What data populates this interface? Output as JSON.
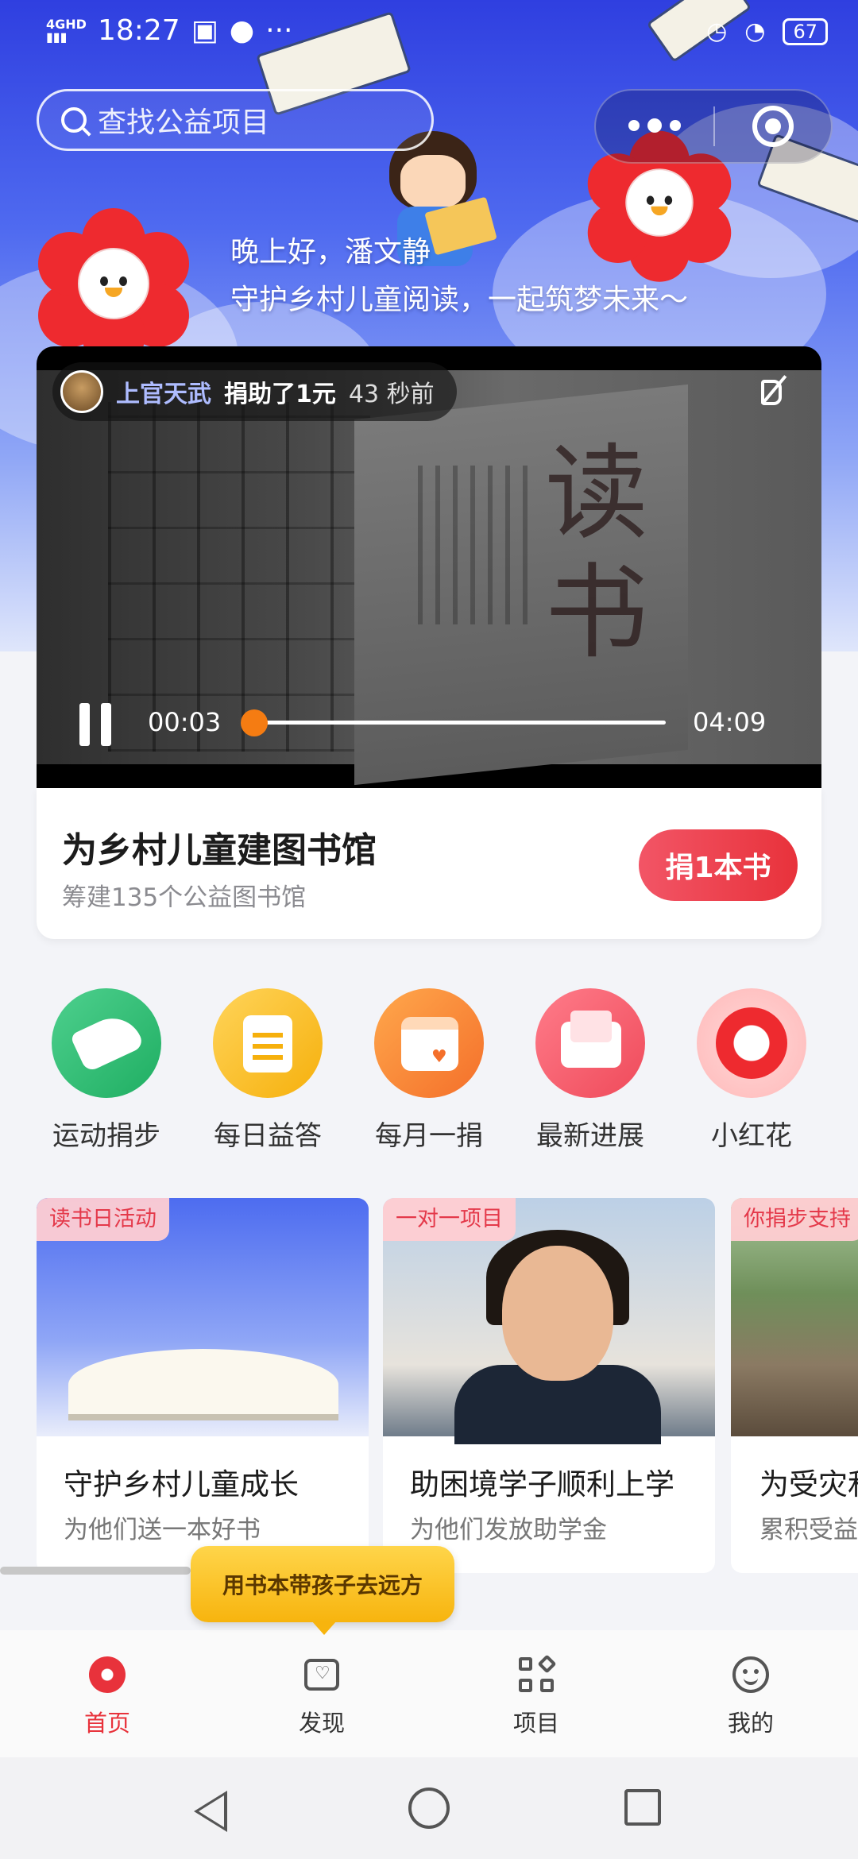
{
  "status_bar": {
    "network": "4GHD",
    "time": "18:27",
    "battery": "67"
  },
  "search": {
    "placeholder": "查找公益项目"
  },
  "greeting": {
    "line1": "晚上好，潘文静",
    "line2": "守护乡村儿童阅读，一起筑梦未来～"
  },
  "video": {
    "donor_name": "上官天武",
    "donor_action": "捐助了1元",
    "donor_time": "43 秒前",
    "current_time": "00:03",
    "total_time": "04:09",
    "progress": 0.012
  },
  "campaign": {
    "title": "为乡村儿童建图书馆",
    "subtitle": "筹建135个公益图书馆",
    "button": "捐1本书"
  },
  "shortcuts": [
    {
      "label": "运动捐步",
      "icon": "shoe-icon"
    },
    {
      "label": "每日益答",
      "icon": "quiz-icon"
    },
    {
      "label": "每月一捐",
      "icon": "calendar-icon"
    },
    {
      "label": "最新进展",
      "icon": "inbox-icon"
    },
    {
      "label": "小红花",
      "icon": "red-flower-icon"
    }
  ],
  "projects": [
    {
      "tag": "读书日活动",
      "title": "守护乡村儿童成长",
      "subtitle": "为他们送一本好书"
    },
    {
      "tag": "一对一项目",
      "title": "助困境学子顺利上学",
      "subtitle": "为他们发放助学金"
    },
    {
      "tag": "你捐步支持",
      "title": "为受灾和",
      "subtitle": "累积受益"
    }
  ],
  "tooltip": "用书本带孩子去远方",
  "tabs": [
    {
      "label": "首页",
      "icon": "home-flower-icon",
      "active": true
    },
    {
      "label": "发现",
      "icon": "discover-icon",
      "active": false
    },
    {
      "label": "项目",
      "icon": "projects-grid-icon",
      "active": false
    },
    {
      "label": "我的",
      "icon": "profile-smile-icon",
      "active": false
    }
  ],
  "colors": {
    "accent": "#e8323b",
    "progress_thumb": "#f57c12",
    "tooltip": "#f7b40e"
  }
}
